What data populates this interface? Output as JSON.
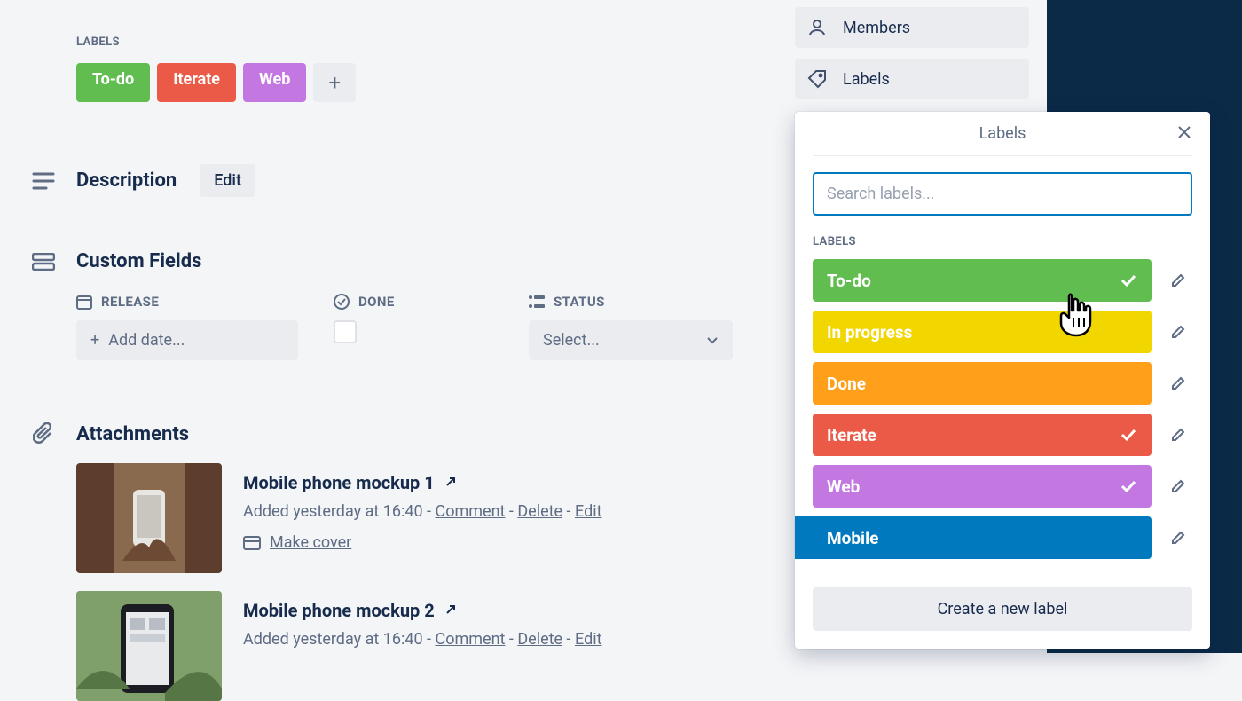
{
  "labels_section": {
    "heading": "LABELS",
    "applied": [
      {
        "name": "To-do",
        "color": "green"
      },
      {
        "name": "Iterate",
        "color": "red"
      },
      {
        "name": "Web",
        "color": "purple"
      }
    ]
  },
  "description": {
    "heading": "Description",
    "edit_label": "Edit"
  },
  "custom_fields": {
    "heading": "Custom Fields",
    "release": {
      "label": "RELEASE",
      "value": "Add date..."
    },
    "done": {
      "label": "DONE",
      "checked": false
    },
    "status": {
      "label": "STATUS",
      "value": "Select..."
    }
  },
  "attachments": {
    "heading": "Attachments",
    "items": [
      {
        "title": "Mobile phone mockup 1",
        "added_text": "Added yesterday at 16:40",
        "comment": "Comment",
        "delete": "Delete",
        "edit": "Edit",
        "make_cover": "Make cover"
      },
      {
        "title": "Mobile phone mockup 2",
        "added_text": "Added yesterday at 16:40",
        "comment": "Comment",
        "delete": "Delete",
        "edit": "Edit"
      }
    ]
  },
  "sidebar": {
    "members": "Members",
    "labels": "Labels"
  },
  "popover": {
    "title": "Labels",
    "search_placeholder": "Search labels...",
    "list_heading": "LABELS",
    "options": [
      {
        "name": "To-do",
        "color": "green",
        "selected": true
      },
      {
        "name": "In progress",
        "color": "yellow",
        "selected": false
      },
      {
        "name": "Done",
        "color": "orange",
        "selected": false
      },
      {
        "name": "Iterate",
        "color": "red",
        "selected": true
      },
      {
        "name": "Web",
        "color": "purple",
        "selected": true
      },
      {
        "name": "Mobile",
        "color": "blue",
        "selected": false
      }
    ],
    "create_label": "Create a new label"
  }
}
